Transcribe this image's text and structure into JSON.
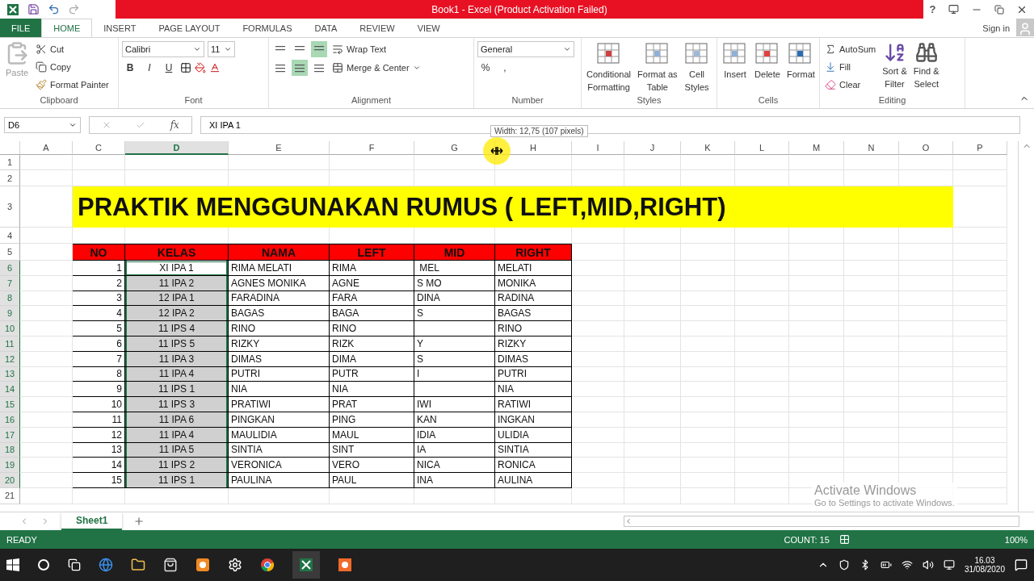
{
  "window": {
    "title": "Book1 -  Excel (Product Activation Failed)",
    "help": "?",
    "sign_in": "Sign in"
  },
  "menu_tabs": [
    {
      "label": "FILE",
      "kind": "file",
      "selected": false
    },
    {
      "label": "HOME",
      "kind": "tab",
      "selected": true
    },
    {
      "label": "INSERT",
      "kind": "tab",
      "selected": false
    },
    {
      "label": "PAGE LAYOUT",
      "kind": "tab",
      "selected": false
    },
    {
      "label": "FORMULAS",
      "kind": "tab",
      "selected": false
    },
    {
      "label": "DATA",
      "kind": "tab",
      "selected": false
    },
    {
      "label": "REVIEW",
      "kind": "tab",
      "selected": false
    },
    {
      "label": "VIEW",
      "kind": "tab",
      "selected": false
    }
  ],
  "clipboard": {
    "paste": "Paste",
    "cut": "Cut",
    "copy": "Copy",
    "format_painter": "Format Painter",
    "label": "Clipboard"
  },
  "font": {
    "name": "Calibri",
    "size": "11",
    "bold": "B",
    "italic": "I",
    "underline": "U",
    "label": "Font"
  },
  "alignment": {
    "wrap_text": "Wrap Text",
    "merge": "Merge & Center",
    "label": "Alignment",
    "align_buttons": [
      {
        "selected": false
      },
      {
        "selected": false
      },
      {
        "selected": true
      },
      {
        "selected": false
      },
      {
        "selected": true
      },
      {
        "selected": false
      }
    ]
  },
  "number": {
    "format": "General",
    "percent": "%",
    "comma": ",",
    "label": "Number"
  },
  "styles": {
    "buttons": [
      {
        "lines": [
          "Conditional",
          "Formatting"
        ]
      },
      {
        "lines": [
          "Format as",
          "Table"
        ]
      },
      {
        "lines": [
          "Cell",
          "Styles"
        ]
      }
    ],
    "label": "Styles"
  },
  "cells": {
    "buttons": [
      "Insert",
      "Delete",
      "Format"
    ],
    "label": "Cells"
  },
  "editing": {
    "autosum": "AutoSum",
    "fill": "Fill",
    "clear": "Clear",
    "sort": [
      "Sort &",
      "Filter"
    ],
    "find": [
      "Find &",
      "Select"
    ],
    "label": "Editing"
  },
  "formula_bar": {
    "name_box": "D6",
    "function_label": "fx",
    "value": "XI IPA 1"
  },
  "tooltip": "Width: 12,75 (107 pixels)",
  "sheet": {
    "columns": [
      {
        "label": "A",
        "selected": false
      },
      {
        "label": "C",
        "selected": false
      },
      {
        "label": "D",
        "selected": true
      },
      {
        "label": "E",
        "selected": false
      },
      {
        "label": "F",
        "selected": false
      },
      {
        "label": "G",
        "selected": false
      },
      {
        "label": "H",
        "selected": false
      },
      {
        "label": "I",
        "selected": false
      },
      {
        "label": "J",
        "selected": false
      },
      {
        "label": "K",
        "selected": false
      },
      {
        "label": "L",
        "selected": false
      },
      {
        "label": "M",
        "selected": false
      },
      {
        "label": "N",
        "selected": false
      },
      {
        "label": "O",
        "selected": false
      },
      {
        "label": "P",
        "selected": false
      }
    ],
    "rows": [
      {
        "label": "1",
        "selected": false
      },
      {
        "label": "2",
        "selected": false
      },
      {
        "label": "3",
        "selected": false
      },
      {
        "label": "4",
        "selected": false
      },
      {
        "label": "5",
        "selected": false
      },
      {
        "label": "6",
        "selected": true
      },
      {
        "label": "7",
        "selected": true
      },
      {
        "label": "8",
        "selected": true
      },
      {
        "label": "9",
        "selected": true
      },
      {
        "label": "10",
        "selected": true
      },
      {
        "label": "11",
        "selected": true
      },
      {
        "label": "12",
        "selected": true
      },
      {
        "label": "13",
        "selected": true
      },
      {
        "label": "14",
        "selected": true
      },
      {
        "label": "15",
        "selected": true
      },
      {
        "label": "16",
        "selected": true
      },
      {
        "label": "17",
        "selected": true
      },
      {
        "label": "18",
        "selected": true
      },
      {
        "label": "19",
        "selected": true
      },
      {
        "label": "20",
        "selected": true
      },
      {
        "label": "21",
        "selected": false
      }
    ],
    "title": "PRAKTIK MENGGUNAKAN RUMUS ( LEFT,MID,RIGHT)",
    "table": {
      "headers": [
        "NO",
        "KELAS",
        "NAMA",
        "LEFT",
        "MID",
        "RIGHT"
      ],
      "rows": [
        {
          "no": "1",
          "kelas": "XI IPA 1",
          "nama": "RIMA MELATI",
          "left": "RIMA",
          "mid": " MEL",
          "right": "MELATI",
          "selected": true,
          "active": true
        },
        {
          "no": "2",
          "kelas": "11 IPA 2",
          "nama": "AGNES MONIKA",
          "left": "AGNE",
          "mid": "S MO",
          "right": "MONIKA",
          "selected": true,
          "active": false
        },
        {
          "no": "3",
          "kelas": "12 IPA 1",
          "nama": "FARADINA",
          "left": "FARA",
          "mid": "DINA",
          "right": "RADINA",
          "selected": true,
          "active": false
        },
        {
          "no": "4",
          "kelas": "12 IPA 2",
          "nama": "BAGAS",
          "left": "BAGA",
          "mid": "S",
          "right": "BAGAS",
          "selected": true,
          "active": false
        },
        {
          "no": "5",
          "kelas": "11 IPS 4",
          "nama": "RINO",
          "left": "RINO",
          "right": "RINO",
          "selected": true,
          "active": false
        },
        {
          "no": "6",
          "kelas": "11 IPS 5",
          "nama": "RIZKY",
          "left": "RIZK",
          "mid": "Y",
          "right": "RIZKY",
          "selected": true,
          "active": false
        },
        {
          "no": "7",
          "kelas": "11 IPA 3",
          "nama": "DIMAS",
          "left": "DIMA",
          "mid": "S",
          "right": "DIMAS",
          "selected": true,
          "active": false
        },
        {
          "no": "8",
          "kelas": "11 IPA 4",
          "nama": "PUTRI",
          "left": "PUTR",
          "mid": "I",
          "right": "PUTRI",
          "selected": true,
          "active": false
        },
        {
          "no": "9",
          "kelas": "11 IPS 1",
          "nama": "NIA",
          "left": "NIA",
          "right": "NIA",
          "selected": true,
          "active": false
        },
        {
          "no": "10",
          "kelas": "11 IPS 3",
          "nama": "PRATIWI",
          "left": "PRAT",
          "mid": "IWI",
          "right": "RATIWI",
          "selected": true,
          "active": false
        },
        {
          "no": "11",
          "kelas": "11 IPA 6",
          "nama": "PINGKAN",
          "left": "PING",
          "mid": "KAN",
          "right": "INGKAN",
          "selected": true,
          "active": false
        },
        {
          "no": "12",
          "kelas": "11 IPA 4",
          "nama": "MAULIDIA",
          "left": "MAUL",
          "mid": "IDIA",
          "right": "ULIDIA",
          "selected": true,
          "active": false
        },
        {
          "no": "13",
          "kelas": "11 IPA 5",
          "nama": "SINTIA",
          "left": "SINT",
          "mid": "IA",
          "right": "SINTIA",
          "selected": true,
          "active": false
        },
        {
          "no": "14",
          "kelas": "11 IPS 2",
          "nama": "VERONICA",
          "left": "VERO",
          "mid": "NICA",
          "right": "RONICA",
          "selected": true,
          "active": false
        },
        {
          "no": "15",
          "kelas": "11 IPS 1",
          "nama": "PAULINA",
          "left": "PAUL",
          "mid": "INA",
          "right": "AULINA",
          "selected": true,
          "active": false
        }
      ]
    }
  },
  "sheet_tabs": [
    {
      "label": "Sheet1",
      "selected": true
    }
  ],
  "activation": {
    "title": "Activate Windows",
    "subtitle": "Go to Settings to activate Windows."
  },
  "status_bar": {
    "mode": "READY",
    "count": "COUNT: 15",
    "zoom": "100%"
  },
  "taskbar": {
    "time": "16.03",
    "date": "31/08/2020"
  }
}
